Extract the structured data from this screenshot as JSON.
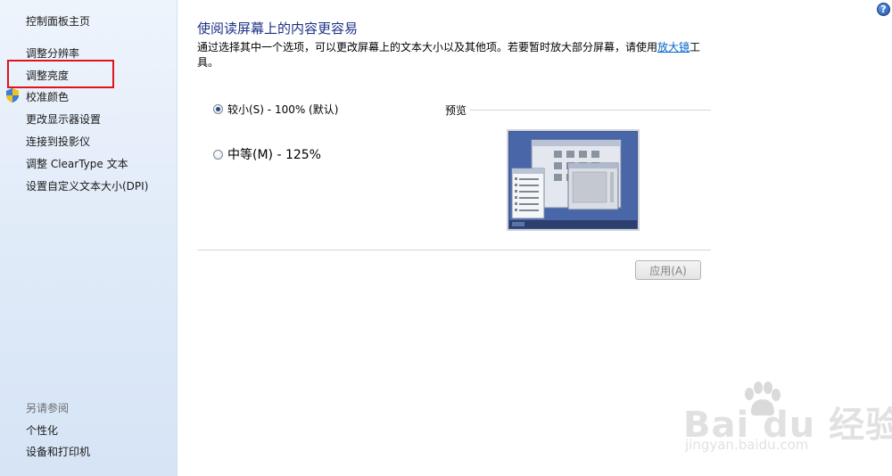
{
  "sidebar": {
    "home": "控制面板主页",
    "items": [
      {
        "label": "调整分辨率"
      },
      {
        "label": "调整亮度"
      },
      {
        "label": "校准颜色"
      },
      {
        "label": "更改显示器设置"
      },
      {
        "label": "连接到投影仪"
      },
      {
        "label": "调整 ClearType 文本"
      },
      {
        "label": "设置自定义文本大小(DPI)"
      }
    ],
    "see_also": "另请参阅",
    "see_also_items": [
      {
        "label": "个性化"
      },
      {
        "label": "设备和打印机"
      }
    ]
  },
  "main": {
    "title": "使阅读屏幕上的内容更容易",
    "description_before": "通过选择其中一个选项，可以更改屏幕上的文本大小以及其他项。若要暂时放大部分屏幕，请使用",
    "description_link": "放大镜",
    "description_after": "工具。",
    "options": [
      {
        "label": "较小(S) - 100% (默认)",
        "selected": true
      },
      {
        "label": "中等(M) - 125%",
        "selected": false
      }
    ],
    "preview_label": "预览",
    "apply_button": "应用(A)"
  },
  "help": {
    "glyph": "?"
  },
  "watermark": {
    "brand": "Bai du 经验",
    "url": "jingyan.baidu.com"
  },
  "colors": {
    "title": "#1e3287",
    "link": "#0066cc",
    "highlight": "#e0141b"
  }
}
